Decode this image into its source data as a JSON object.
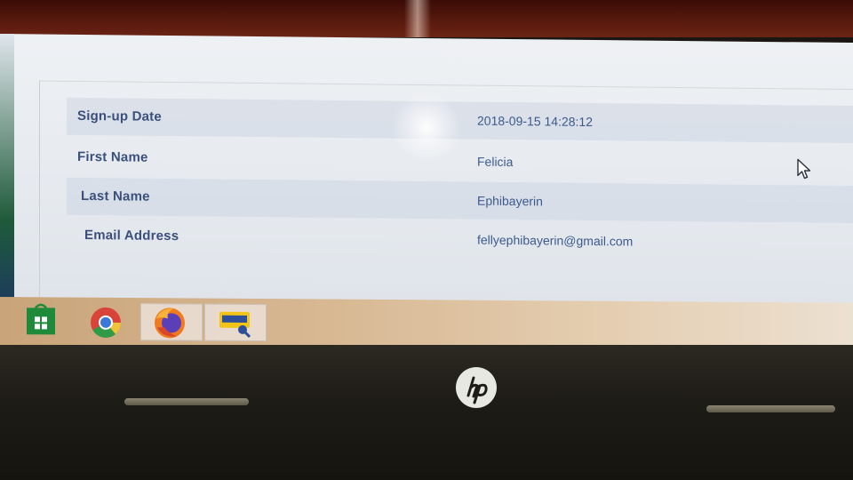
{
  "profile": {
    "rows": [
      {
        "label": "Sign-up Date",
        "value": "2018-09-15 14:28:12"
      },
      {
        "label": "First Name",
        "value": "Felicia"
      },
      {
        "label": "Last Name",
        "value": "Ephibayerin"
      },
      {
        "label": "Email Address",
        "value": "fellyephibayerin@gmail.com"
      }
    ]
  },
  "taskbar": {
    "items": [
      {
        "name": "microsoft-store",
        "icon": "store-icon",
        "active": false
      },
      {
        "name": "chrome",
        "icon": "chrome-icon",
        "active": false
      },
      {
        "name": "firefox",
        "icon": "firefox-icon",
        "active": true
      },
      {
        "name": "network-app",
        "icon": "network-app-icon",
        "active": true
      }
    ]
  },
  "device": {
    "brand_logo": "hp-logo"
  },
  "colors": {
    "label_text": "#3a4f7a",
    "value_text": "#3d5a8c",
    "row_shade": "#cdd6e2",
    "taskbar": "#d8b994",
    "bezel": "#5a1a0e"
  }
}
